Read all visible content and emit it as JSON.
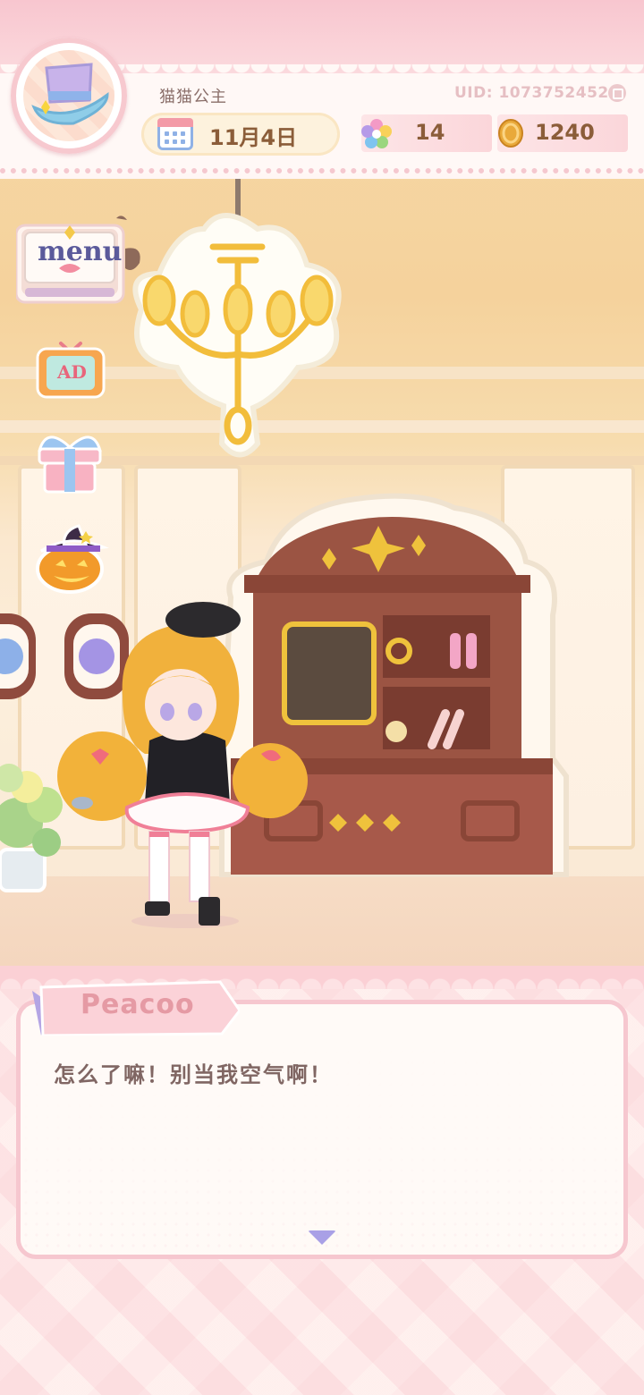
{
  "player": {
    "name": "猫猫公主",
    "uid": "UID: 1073752452"
  },
  "hud": {
    "date": "11月4日",
    "weather_icon": "sun-icon",
    "gems": "14",
    "coins": "1240"
  },
  "side_menu": {
    "menu_label": "menu",
    "ad_label": "AD",
    "gift_icon": "gift-icon",
    "event_icon": "pumpkin-witch-hat-icon"
  },
  "dialogue": {
    "speaker": "Peacoo",
    "text": "怎么了嘛！别当我空气啊！",
    "continue_icon": "triangle-down-icon"
  },
  "colors": {
    "accent_pink": "#f6c7cf",
    "text_brown": "#8b5d39",
    "dialogue_text": "#806663",
    "speaker_pink": "#e59aa4"
  }
}
